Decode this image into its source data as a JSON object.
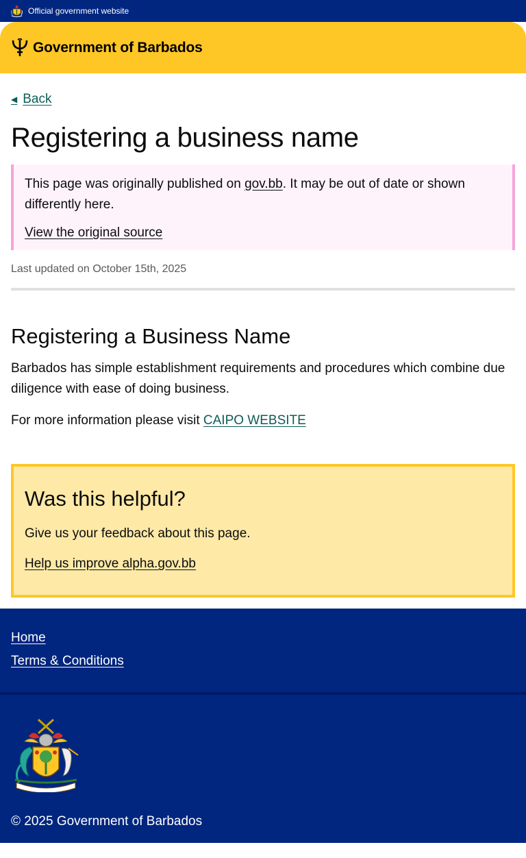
{
  "banner": {
    "text": "Official government website",
    "icon": "coat-of-arms-icon"
  },
  "header": {
    "logo_icon": "trident-icon",
    "brand": "Government of Barbados"
  },
  "nav": {
    "back_label": "Back",
    "back_icon": "arrow-left-icon"
  },
  "page": {
    "title": "Registering a business name",
    "notice": {
      "text_before": "This page was originally published on ",
      "link": "gov.bb",
      "text_after": ". It may be out of date or shown differently here.",
      "source_link": "View the original source"
    },
    "last_updated": "Last updated on October 15th, 2025"
  },
  "content": {
    "heading": "Registering a Business Name",
    "paragraph1": "Barbados has simple establishment requirements and procedures which combine due diligence with ease of doing business.",
    "paragraph2_prefix": "For more information please visit ",
    "paragraph2_link": "CAIPO WEBSITE"
  },
  "feedback": {
    "title": "Was this helpful?",
    "text": "Give us your feedback about this page.",
    "link": "Help us improve alpha.gov.bb"
  },
  "footer": {
    "links": [
      "Home",
      "Terms & Conditions"
    ],
    "copyright": "© 2025 Government of Barbados"
  },
  "colors": {
    "navy": "#00267f",
    "gold": "#ffc726",
    "notice_bg": "#fef3fb",
    "notice_border": "#f6a3d9",
    "feedback_bg": "#fee9a7",
    "link_teal": "#0e5c57"
  }
}
